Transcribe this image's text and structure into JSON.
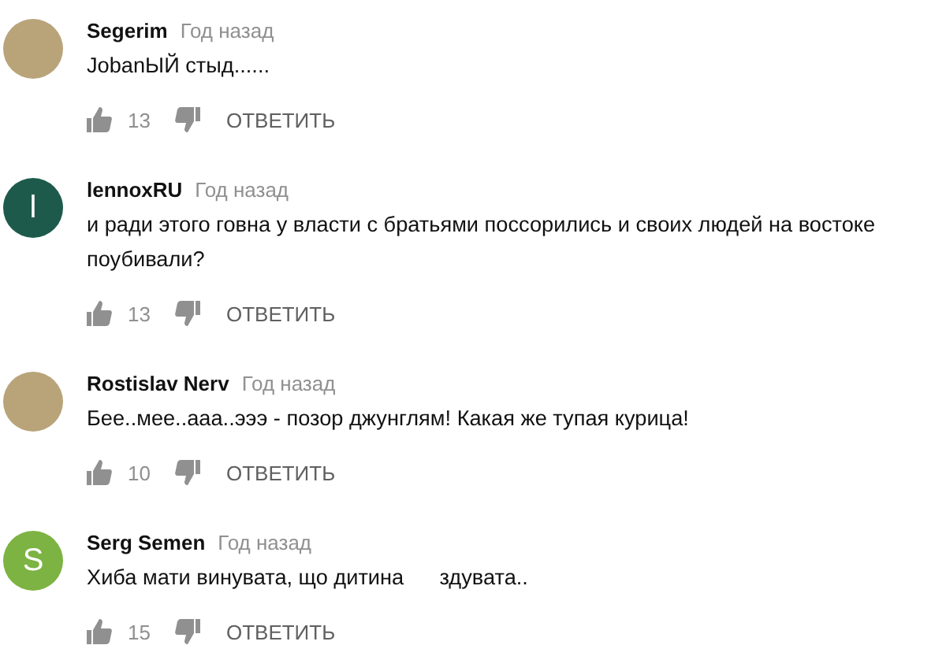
{
  "comments": [
    {
      "author": "Segerim",
      "time": "Год назад",
      "text": "JobanЫЙ стыд......",
      "likes": "13",
      "reply": "ОТВЕТИТЬ",
      "avatar": {
        "kind": "photo"
      }
    },
    {
      "author": "lennoxRU",
      "time": "Год назад",
      "text": "и ради этого говна у власти с братьями поссорились и своих людей на востоке поубивали?",
      "likes": "13",
      "reply": "ОТВЕТИТЬ",
      "avatar": {
        "kind": "letter",
        "letter": "l",
        "color": "#1d5a4c"
      }
    },
    {
      "author": "Rostislav Nerv",
      "time": "Год назад",
      "text": "Бее..мее..ааа..эээ - позор джунглям! Какая же тупая курица!",
      "likes": "10",
      "reply": "ОТВЕТИТЬ",
      "avatar": {
        "kind": "photo"
      }
    },
    {
      "author": "Serg Semen",
      "time": "Год назад",
      "text": "Хиба мати винувата, що дитина      здувата..",
      "likes": "15",
      "reply": "ОТВЕТИТЬ",
      "avatar": {
        "kind": "letter",
        "letter": "S",
        "color": "#7cb342"
      }
    }
  ]
}
